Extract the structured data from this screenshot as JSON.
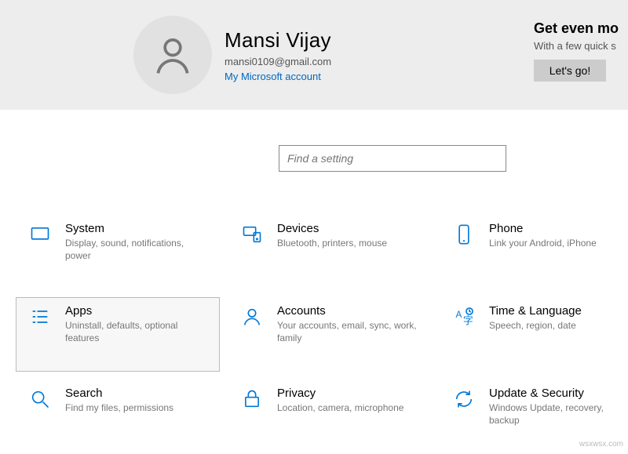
{
  "user": {
    "name": "Mansi Vijay",
    "email": "mansi0109@gmail.com",
    "account_link": "My Microsoft account"
  },
  "promo": {
    "title": "Get even mo",
    "subtitle": "With a few quick s",
    "button": "Let's go!"
  },
  "search": {
    "placeholder": "Find a setting"
  },
  "tiles": {
    "system": {
      "title": "System",
      "desc": "Display, sound, notifications, power"
    },
    "devices": {
      "title": "Devices",
      "desc": "Bluetooth, printers, mouse"
    },
    "phone": {
      "title": "Phone",
      "desc": "Link your Android, iPhone"
    },
    "apps": {
      "title": "Apps",
      "desc": "Uninstall, defaults, optional features"
    },
    "accounts": {
      "title": "Accounts",
      "desc": "Your accounts, email, sync, work, family"
    },
    "time": {
      "title": "Time & Language",
      "desc": "Speech, region, date"
    },
    "search_tile": {
      "title": "Search",
      "desc": "Find my files, permissions"
    },
    "privacy": {
      "title": "Privacy",
      "desc": "Location, camera, microphone"
    },
    "update": {
      "title": "Update & Security",
      "desc": "Windows Update, recovery, backup"
    }
  },
  "watermark": "wsxwsx.com"
}
